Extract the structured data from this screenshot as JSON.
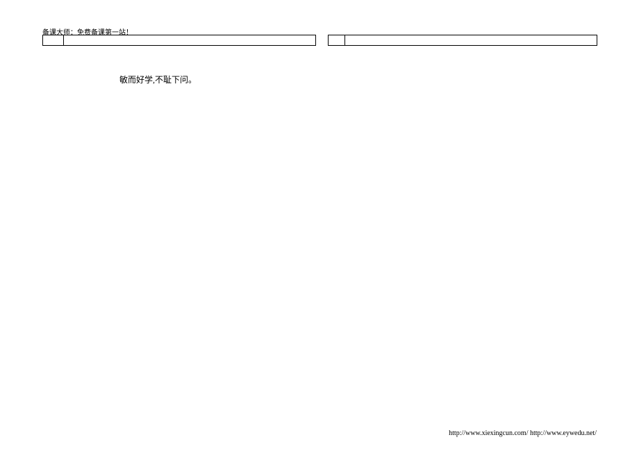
{
  "header": {
    "site_tagline": "备课大师：免费备课第一站！"
  },
  "content": {
    "quote": "敏而好学,不耻下问。"
  },
  "footer": {
    "urls": "http://www.xiexingcun.com/ http://www.eywedu.net/"
  }
}
